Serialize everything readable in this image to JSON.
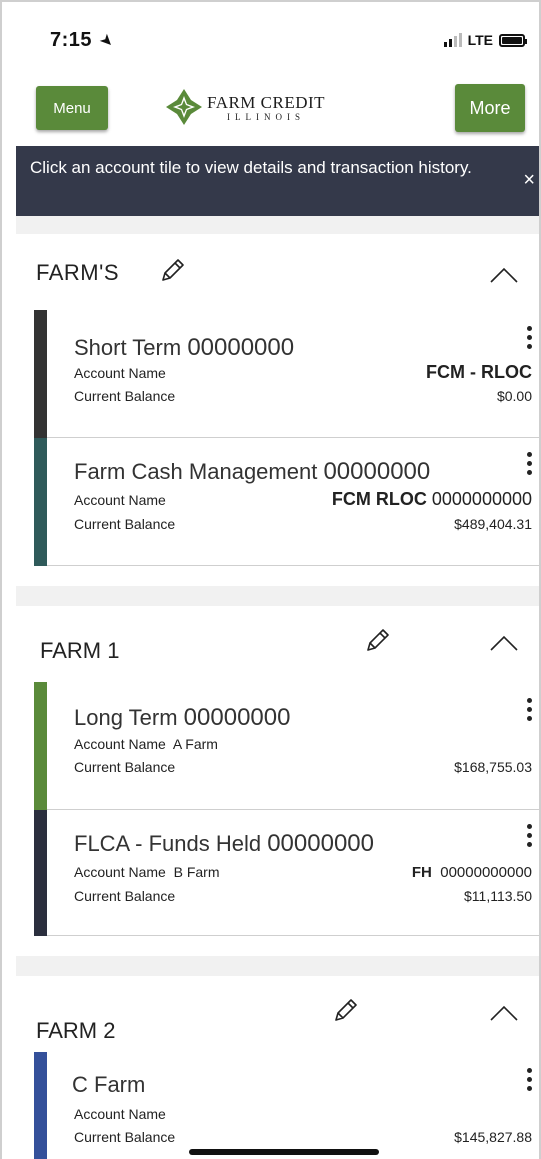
{
  "status_bar": {
    "time": "7:15",
    "network": "LTE"
  },
  "header": {
    "menu_label": "Menu",
    "more_label": "More",
    "logo_main": "FARM CREDIT",
    "logo_sub": "ILLINOIS"
  },
  "banner": {
    "text": "Click an account tile to view details and transaction history.",
    "close": "×"
  },
  "groups": [
    {
      "title": "FARM'S",
      "tiles": [
        {
          "title": "Short Term",
          "number": "00000000",
          "account_label": "Account Name",
          "account_value": "",
          "balance_label": "Current Balance",
          "right_bold": "FCM - RLOC",
          "right_num": "",
          "balance": "$0.00",
          "bar_color": "#333333"
        },
        {
          "title": "Farm Cash Management",
          "number": "00000000",
          "account_label": "Account Name",
          "account_value": "",
          "balance_label": "Current Balance",
          "right_bold": "FCM RLOC",
          "right_num": "0000000000",
          "balance": "$489,404.31",
          "bar_color": "#2f5a5a"
        }
      ]
    },
    {
      "title": "FARM 1",
      "tiles": [
        {
          "title": "Long Term",
          "number": "00000000",
          "account_label": "Account Name",
          "account_value": "A Farm",
          "balance_label": "Current Balance",
          "right_bold": "",
          "right_num": "",
          "balance": "$168,755.03",
          "bar_color": "#5a8a3a"
        },
        {
          "title": "FLCA - Funds Held",
          "number": "00000000",
          "account_label": "Account Name",
          "account_value": "B Farm",
          "balance_label": "Current Balance",
          "right_bold": "FH",
          "right_num": "00000000000",
          "balance": "$11,113.50",
          "bar_color": "#2b2f3e"
        }
      ]
    },
    {
      "title": "FARM 2",
      "tiles": [
        {
          "title": "C Farm",
          "number": "",
          "account_label": "Account Name",
          "account_value": "",
          "balance_label": "Current Balance",
          "right_bold": "",
          "right_num": "",
          "balance": "$145,827.88",
          "bar_color": "#34509a"
        }
      ]
    }
  ],
  "colors": {
    "brand_green": "#5a8a3a",
    "banner_bg": "#34394a",
    "section_gap": "#f1f1f1"
  },
  "icons": [
    "location-arrow-icon",
    "signal-icon",
    "battery-icon",
    "farm-credit-logo-icon",
    "close-icon",
    "pencil-icon",
    "chevron-up-icon",
    "more-vertical-icon"
  ]
}
